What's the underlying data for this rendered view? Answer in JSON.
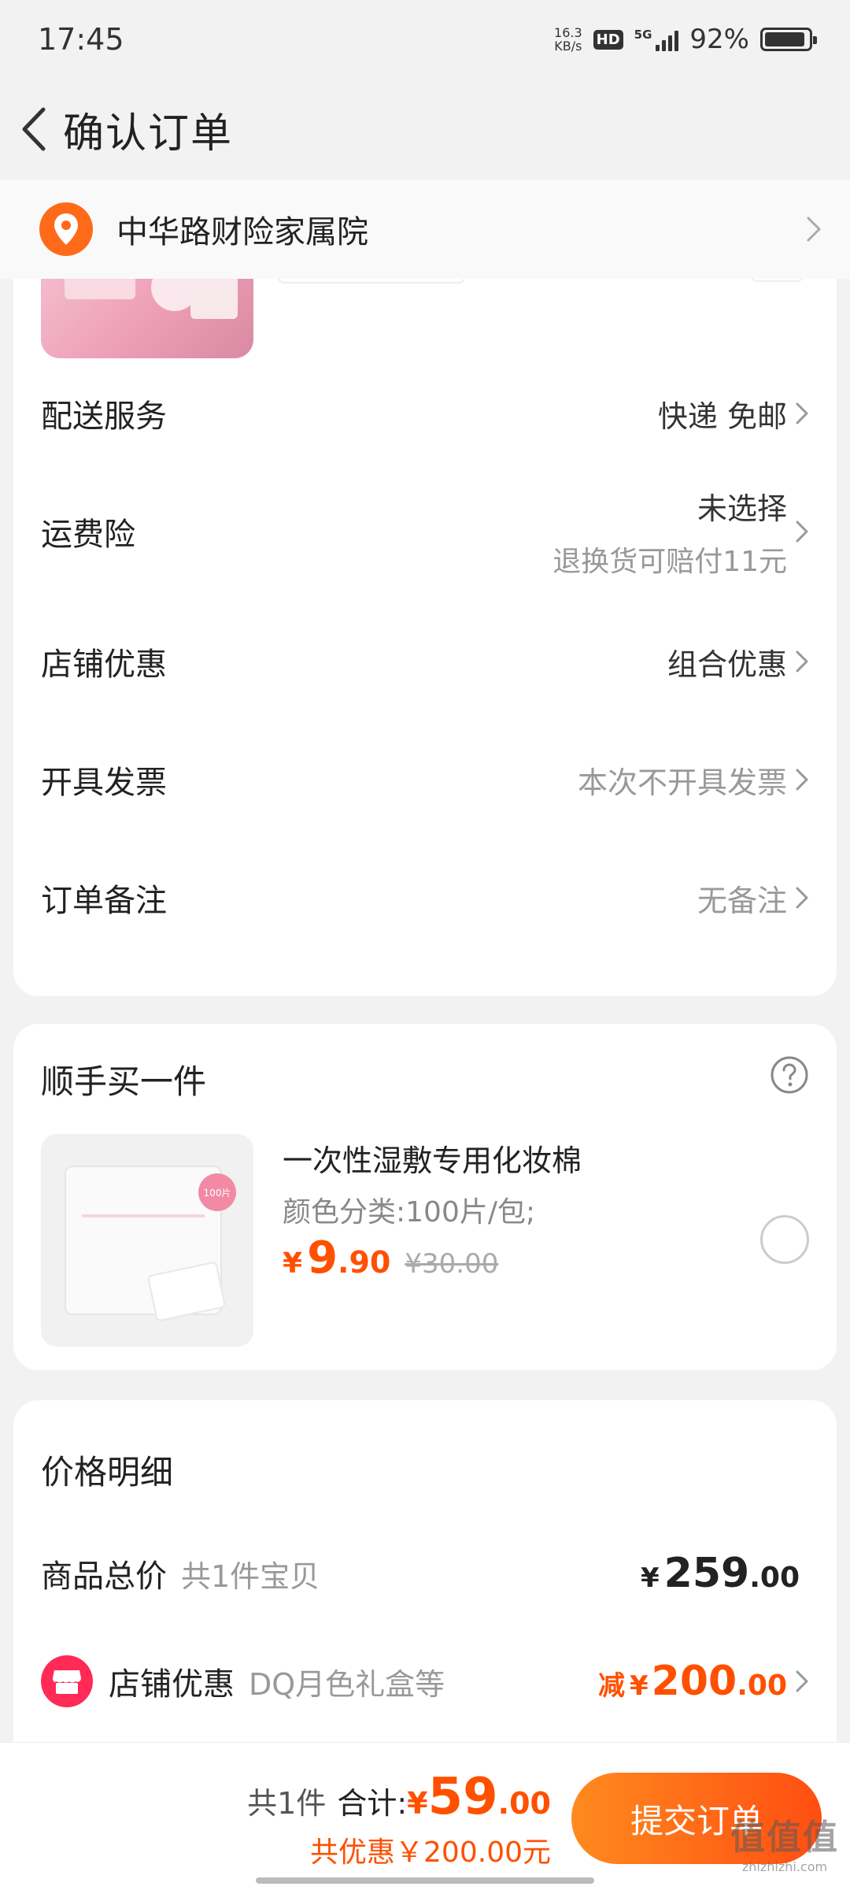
{
  "status_bar": {
    "time": "17:45",
    "net_speed_value": "16.3",
    "net_speed_unit": "KB/s",
    "hd": "HD",
    "signal": "5G",
    "battery": "92%"
  },
  "header": {
    "title": "确认订单"
  },
  "address": {
    "text": "中华路财险家属院"
  },
  "order_rows": [
    {
      "label": "配送服务",
      "value": "快递 免邮"
    },
    {
      "label": "运费险",
      "value": "未选择",
      "subvalue": "退换货可赔付11元"
    },
    {
      "label": "店铺优惠",
      "value": "组合优惠"
    },
    {
      "label": "开具发票",
      "value": "本次不开具发票"
    },
    {
      "label": "订单备注",
      "value": "无备注"
    }
  ],
  "add_on": {
    "title": "顺手买一件",
    "name": "一次性湿敷专用化妆棉",
    "spec": "颜色分类:100片/包;",
    "badge": "100片",
    "currency": "¥",
    "price_int": "9",
    "price_dec": ".90",
    "old_price": "¥30.00"
  },
  "price_detail": {
    "title": "价格明细",
    "total_label": "商品总价",
    "total_sub": "共1件宝贝",
    "total_currency": "¥",
    "total_int": "259",
    "total_dec": ".00",
    "discount_label": "店铺优惠",
    "discount_sub": "DQ月色礼盒等",
    "discount_prefix": "减",
    "discount_currency": "¥",
    "discount_int": "200",
    "discount_dec": ".00"
  },
  "bottom": {
    "count": "共1件",
    "sum_label": "合计:",
    "currency": "¥",
    "sum_int": "59",
    "sum_dec": ".00",
    "savings": "共优惠￥200.00元",
    "submit_label": "提交订单"
  },
  "watermark": {
    "logo": "值值值",
    "site": "zhizhizhi.com"
  },
  "colors": {
    "accent": "#ff5000",
    "button_start": "#ff8a1e",
    "button_end": "#ff4e12",
    "store_icon": "#ff2a55",
    "pin": "#ff6a1a"
  }
}
